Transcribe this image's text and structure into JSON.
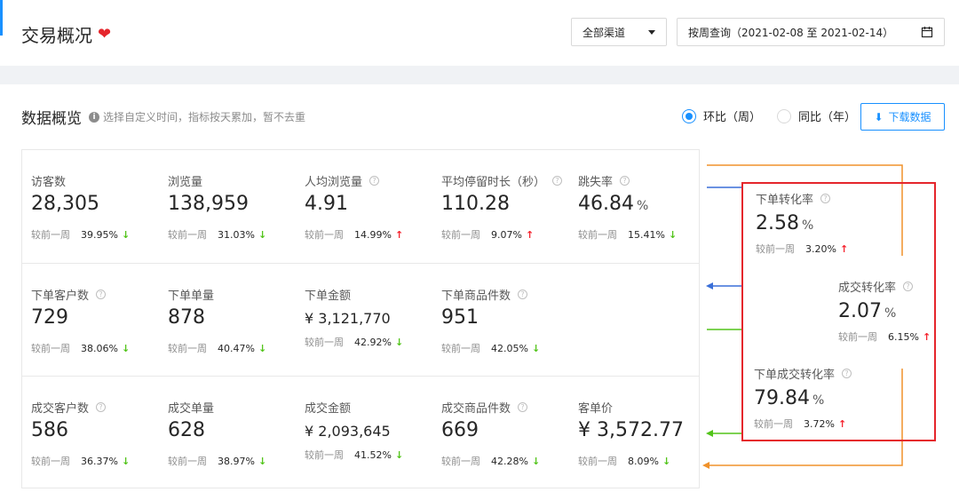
{
  "header": {
    "title": "交易概况",
    "channel_select": "全部渠道",
    "date_range": "按周查询（2021-02-08 至 2021-02-14）"
  },
  "overview": {
    "title": "数据概览",
    "hint": "选择自定义时间，指标按天累加，暂不去重",
    "radio_wow": "环比（周）",
    "radio_yoy": "同比（年）",
    "download_label": "下载数据",
    "compare_label": "较前一周"
  },
  "metrics": {
    "visitors": {
      "label": "访客数",
      "value": "28,305",
      "pct": "39.95%",
      "trend": "down"
    },
    "pageviews": {
      "label": "浏览量",
      "value": "138,959",
      "pct": "31.03%",
      "trend": "down"
    },
    "pv_per_user": {
      "label": "人均浏览量",
      "value": "4.91",
      "pct": "14.99%",
      "trend": "up"
    },
    "avg_stay": {
      "label": "平均停留时长（秒）",
      "value": "110.28",
      "pct": "9.07%",
      "trend": "up"
    },
    "bounce": {
      "label": "跳失率",
      "value": "46.84",
      "unit": "%",
      "pct": "15.41%",
      "trend": "down"
    },
    "order_customers": {
      "label": "下单客户数",
      "value": "729",
      "pct": "38.06%",
      "trend": "down"
    },
    "order_count": {
      "label": "下单单量",
      "value": "878",
      "pct": "40.47%",
      "trend": "down"
    },
    "order_amount": {
      "label": "下单金额",
      "value": "¥ 3,121,770",
      "pct": "42.92%",
      "trend": "down"
    },
    "order_items": {
      "label": "下单商品件数",
      "value": "951",
      "pct": "42.05%",
      "trend": "down"
    },
    "deal_customers": {
      "label": "成交客户数",
      "value": "586",
      "pct": "36.37%",
      "trend": "down"
    },
    "deal_count": {
      "label": "成交单量",
      "value": "628",
      "pct": "38.97%",
      "trend": "down"
    },
    "deal_amount": {
      "label": "成交金额",
      "value": "¥ 2,093,645",
      "pct": "41.52%",
      "trend": "down"
    },
    "deal_items": {
      "label": "成交商品件数",
      "value": "669",
      "pct": "42.28%",
      "trend": "down"
    },
    "avg_order_value": {
      "label": "客单价",
      "value": "¥ 3,572.77",
      "pct": "8.09%",
      "trend": "down"
    }
  },
  "conversion": {
    "order_rate": {
      "label": "下单转化率",
      "value": "2.58",
      "unit": "%",
      "pct": "3.20%",
      "trend": "up"
    },
    "deal_rate": {
      "label": "成交转化率",
      "value": "2.07",
      "unit": "%",
      "pct": "6.15%",
      "trend": "up"
    },
    "order_deal_rate": {
      "label": "下单成交转化率",
      "value": "79.84",
      "unit": "%",
      "pct": "3.72%",
      "trend": "up"
    }
  },
  "symbols": {
    "help": "?",
    "info": "i",
    "heart": "❤",
    "arrow_up": "↑",
    "arrow_down": "↓",
    "download_glyph": "⬇"
  },
  "colors": {
    "primary": "#1890ff",
    "highlight": "#e5262c",
    "up": "#f5222d",
    "down": "#52c41a",
    "line_orange": "#f0922b",
    "line_blue": "#3a6fd8",
    "line_green": "#52c41a"
  }
}
